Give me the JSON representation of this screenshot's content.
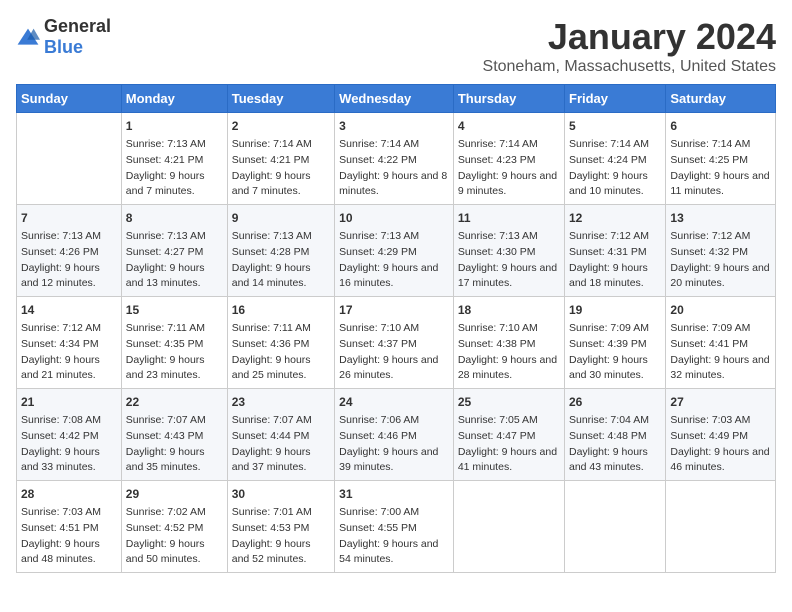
{
  "logo": {
    "general": "General",
    "blue": "Blue"
  },
  "title": "January 2024",
  "subtitle": "Stoneham, Massachusetts, United States",
  "days_of_week": [
    "Sunday",
    "Monday",
    "Tuesday",
    "Wednesday",
    "Thursday",
    "Friday",
    "Saturday"
  ],
  "weeks": [
    [
      {
        "day": "",
        "sunrise": "",
        "sunset": "",
        "daylight": ""
      },
      {
        "day": "1",
        "sunrise": "Sunrise: 7:13 AM",
        "sunset": "Sunset: 4:21 PM",
        "daylight": "Daylight: 9 hours and 7 minutes."
      },
      {
        "day": "2",
        "sunrise": "Sunrise: 7:14 AM",
        "sunset": "Sunset: 4:21 PM",
        "daylight": "Daylight: 9 hours and 7 minutes."
      },
      {
        "day": "3",
        "sunrise": "Sunrise: 7:14 AM",
        "sunset": "Sunset: 4:22 PM",
        "daylight": "Daylight: 9 hours and 8 minutes."
      },
      {
        "day": "4",
        "sunrise": "Sunrise: 7:14 AM",
        "sunset": "Sunset: 4:23 PM",
        "daylight": "Daylight: 9 hours and 9 minutes."
      },
      {
        "day": "5",
        "sunrise": "Sunrise: 7:14 AM",
        "sunset": "Sunset: 4:24 PM",
        "daylight": "Daylight: 9 hours and 10 minutes."
      },
      {
        "day": "6",
        "sunrise": "Sunrise: 7:14 AM",
        "sunset": "Sunset: 4:25 PM",
        "daylight": "Daylight: 9 hours and 11 minutes."
      }
    ],
    [
      {
        "day": "7",
        "sunrise": "Sunrise: 7:13 AM",
        "sunset": "Sunset: 4:26 PM",
        "daylight": "Daylight: 9 hours and 12 minutes."
      },
      {
        "day": "8",
        "sunrise": "Sunrise: 7:13 AM",
        "sunset": "Sunset: 4:27 PM",
        "daylight": "Daylight: 9 hours and 13 minutes."
      },
      {
        "day": "9",
        "sunrise": "Sunrise: 7:13 AM",
        "sunset": "Sunset: 4:28 PM",
        "daylight": "Daylight: 9 hours and 14 minutes."
      },
      {
        "day": "10",
        "sunrise": "Sunrise: 7:13 AM",
        "sunset": "Sunset: 4:29 PM",
        "daylight": "Daylight: 9 hours and 16 minutes."
      },
      {
        "day": "11",
        "sunrise": "Sunrise: 7:13 AM",
        "sunset": "Sunset: 4:30 PM",
        "daylight": "Daylight: 9 hours and 17 minutes."
      },
      {
        "day": "12",
        "sunrise": "Sunrise: 7:12 AM",
        "sunset": "Sunset: 4:31 PM",
        "daylight": "Daylight: 9 hours and 18 minutes."
      },
      {
        "day": "13",
        "sunrise": "Sunrise: 7:12 AM",
        "sunset": "Sunset: 4:32 PM",
        "daylight": "Daylight: 9 hours and 20 minutes."
      }
    ],
    [
      {
        "day": "14",
        "sunrise": "Sunrise: 7:12 AM",
        "sunset": "Sunset: 4:34 PM",
        "daylight": "Daylight: 9 hours and 21 minutes."
      },
      {
        "day": "15",
        "sunrise": "Sunrise: 7:11 AM",
        "sunset": "Sunset: 4:35 PM",
        "daylight": "Daylight: 9 hours and 23 minutes."
      },
      {
        "day": "16",
        "sunrise": "Sunrise: 7:11 AM",
        "sunset": "Sunset: 4:36 PM",
        "daylight": "Daylight: 9 hours and 25 minutes."
      },
      {
        "day": "17",
        "sunrise": "Sunrise: 7:10 AM",
        "sunset": "Sunset: 4:37 PM",
        "daylight": "Daylight: 9 hours and 26 minutes."
      },
      {
        "day": "18",
        "sunrise": "Sunrise: 7:10 AM",
        "sunset": "Sunset: 4:38 PM",
        "daylight": "Daylight: 9 hours and 28 minutes."
      },
      {
        "day": "19",
        "sunrise": "Sunrise: 7:09 AM",
        "sunset": "Sunset: 4:39 PM",
        "daylight": "Daylight: 9 hours and 30 minutes."
      },
      {
        "day": "20",
        "sunrise": "Sunrise: 7:09 AM",
        "sunset": "Sunset: 4:41 PM",
        "daylight": "Daylight: 9 hours and 32 minutes."
      }
    ],
    [
      {
        "day": "21",
        "sunrise": "Sunrise: 7:08 AM",
        "sunset": "Sunset: 4:42 PM",
        "daylight": "Daylight: 9 hours and 33 minutes."
      },
      {
        "day": "22",
        "sunrise": "Sunrise: 7:07 AM",
        "sunset": "Sunset: 4:43 PM",
        "daylight": "Daylight: 9 hours and 35 minutes."
      },
      {
        "day": "23",
        "sunrise": "Sunrise: 7:07 AM",
        "sunset": "Sunset: 4:44 PM",
        "daylight": "Daylight: 9 hours and 37 minutes."
      },
      {
        "day": "24",
        "sunrise": "Sunrise: 7:06 AM",
        "sunset": "Sunset: 4:46 PM",
        "daylight": "Daylight: 9 hours and 39 minutes."
      },
      {
        "day": "25",
        "sunrise": "Sunrise: 7:05 AM",
        "sunset": "Sunset: 4:47 PM",
        "daylight": "Daylight: 9 hours and 41 minutes."
      },
      {
        "day": "26",
        "sunrise": "Sunrise: 7:04 AM",
        "sunset": "Sunset: 4:48 PM",
        "daylight": "Daylight: 9 hours and 43 minutes."
      },
      {
        "day": "27",
        "sunrise": "Sunrise: 7:03 AM",
        "sunset": "Sunset: 4:49 PM",
        "daylight": "Daylight: 9 hours and 46 minutes."
      }
    ],
    [
      {
        "day": "28",
        "sunrise": "Sunrise: 7:03 AM",
        "sunset": "Sunset: 4:51 PM",
        "daylight": "Daylight: 9 hours and 48 minutes."
      },
      {
        "day": "29",
        "sunrise": "Sunrise: 7:02 AM",
        "sunset": "Sunset: 4:52 PM",
        "daylight": "Daylight: 9 hours and 50 minutes."
      },
      {
        "day": "30",
        "sunrise": "Sunrise: 7:01 AM",
        "sunset": "Sunset: 4:53 PM",
        "daylight": "Daylight: 9 hours and 52 minutes."
      },
      {
        "day": "31",
        "sunrise": "Sunrise: 7:00 AM",
        "sunset": "Sunset: 4:55 PM",
        "daylight": "Daylight: 9 hours and 54 minutes."
      },
      {
        "day": "",
        "sunrise": "",
        "sunset": "",
        "daylight": ""
      },
      {
        "day": "",
        "sunrise": "",
        "sunset": "",
        "daylight": ""
      },
      {
        "day": "",
        "sunrise": "",
        "sunset": "",
        "daylight": ""
      }
    ]
  ]
}
